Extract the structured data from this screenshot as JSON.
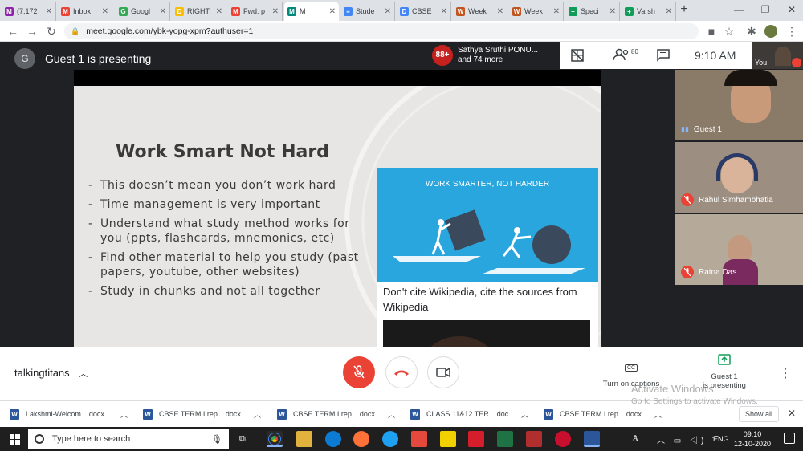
{
  "browser": {
    "tabs": [
      {
        "label": "(7,172",
        "color": "#8e24aa",
        "glyph": "M"
      },
      {
        "label": "Inbox",
        "color": "#ea4335",
        "glyph": "M"
      },
      {
        "label": "Googl",
        "color": "#34a853",
        "glyph": "G"
      },
      {
        "label": "RIGHT",
        "color": "#fbbc04",
        "glyph": "D"
      },
      {
        "label": "Fwd: p",
        "color": "#ea4335",
        "glyph": "M"
      },
      {
        "label": "M",
        "color": "#00897b",
        "glyph": "M"
      },
      {
        "label": "Stude",
        "color": "#4285f4",
        "glyph": "≡"
      },
      {
        "label": "CBSE",
        "color": "#4285f4",
        "glyph": "D"
      },
      {
        "label": "Week",
        "color": "#c1551f",
        "glyph": "W"
      },
      {
        "label": "Week",
        "color": "#c1551f",
        "glyph": "W"
      },
      {
        "label": "Speci",
        "color": "#0f9d58",
        "glyph": "+"
      },
      {
        "label": "Varsh",
        "color": "#0f9d58",
        "glyph": "+"
      }
    ],
    "new_tab": "+",
    "url": "meet.google.com/ybk-yopg-xpm?authuser=1"
  },
  "meet": {
    "presenter_avatar": "G",
    "presenting_text": "Guest 1 is presenting",
    "participants_badge": "88+",
    "participants_line1": "Sathya Sruthi PONU...",
    "participants_line2": "and 74 more",
    "people_count": "80",
    "time": "9:10 AM",
    "you_label": "You",
    "meeting_name": "talkingtitans",
    "captions_label": "Turn on captions",
    "presenting_btn_line1": "Guest 1",
    "presenting_btn_line2": "is presenting"
  },
  "slide": {
    "title": "Work Smart Not Hard",
    "bullets": [
      "This doesn’t mean you don’t work hard",
      "Time management is very important",
      "Understand what study method works for you (ppts, flashcards, mnemonics, etc)",
      "Find other material to help you study (past papers, youtube, other websites)",
      "Study in chunks and not all together"
    ],
    "card_title": "WORK SMARTER, NOT HARDER",
    "card_caption": "Don't cite Wikipedia, cite the sources from Wikipedia"
  },
  "tiles": [
    {
      "name": "Guest 1",
      "bg": "#8a7a68",
      "muted": false
    },
    {
      "name": "Rahul Simhambhatla",
      "bg": "#9c8f82",
      "muted": true
    },
    {
      "name": "Ratna Das",
      "bg": "#b5a99a",
      "muted": true
    }
  ],
  "downloads": {
    "items": [
      "Lakshmi-Welcom....docx",
      "CBSE TERM I rep....docx",
      "CBSE TERM I rep....docx",
      "CLASS 11&12 TER....doc",
      "CBSE TERM I rep....docx"
    ],
    "show_all": "Show all"
  },
  "watermark": {
    "line1": "Activate Windows",
    "line2": "Go to Settings to activate Windows."
  },
  "taskbar": {
    "search_placeholder": "Type here to search",
    "lang": "ENG",
    "clock_time": "09:10",
    "clock_date": "12-10-2020"
  }
}
